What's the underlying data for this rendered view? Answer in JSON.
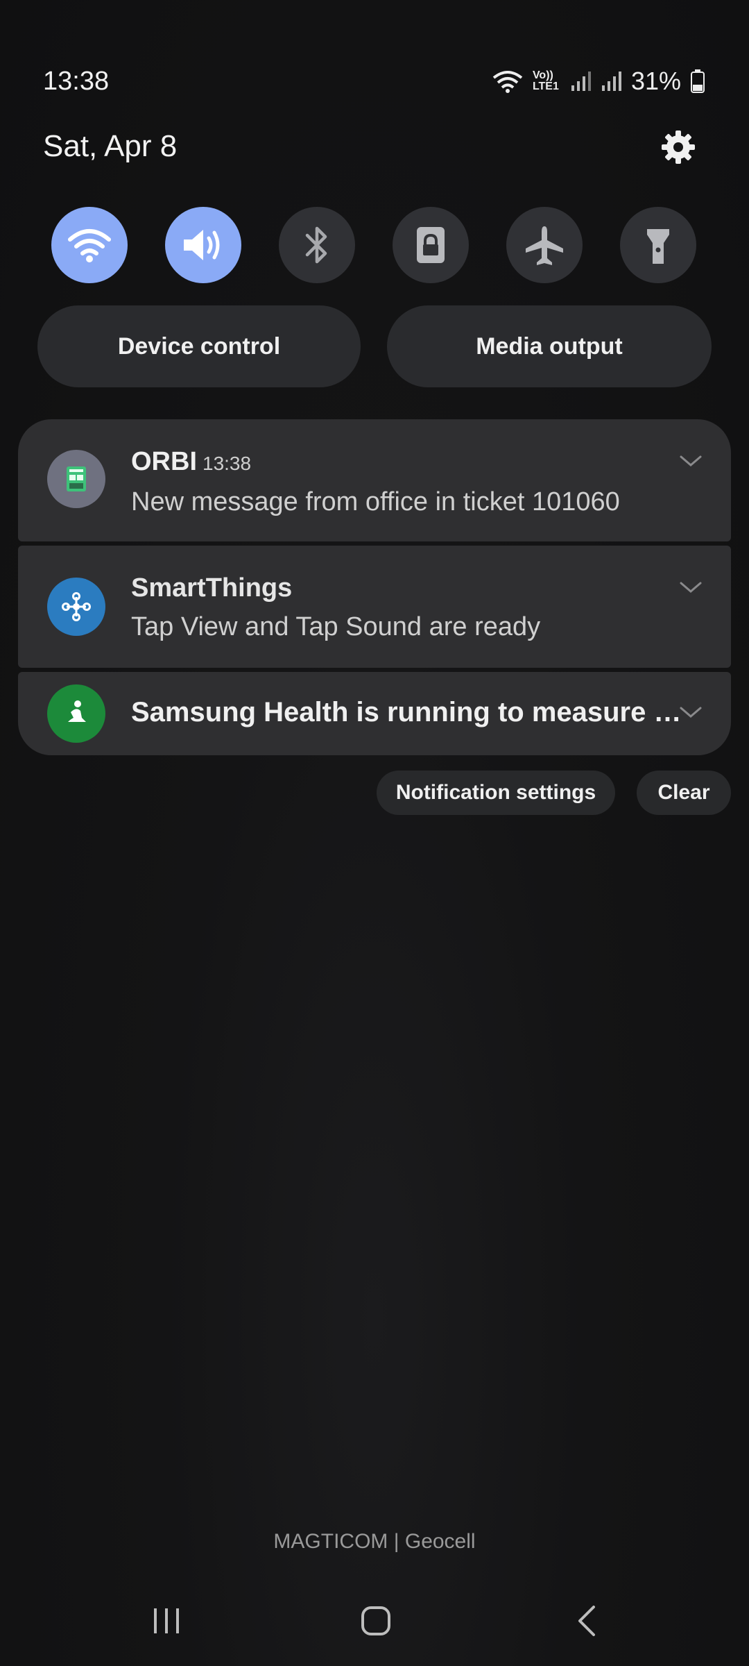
{
  "status_bar": {
    "time": "13:38",
    "network_label": "Vo)) LTE1",
    "battery_percent": "31%"
  },
  "header": {
    "date": "Sat, Apr 8",
    "settings_icon": "gear-icon"
  },
  "quick_settings": {
    "toggles": [
      {
        "name": "wifi",
        "icon": "wifi-icon",
        "on": true
      },
      {
        "name": "sound",
        "icon": "sound-icon",
        "on": true
      },
      {
        "name": "bluetooth",
        "icon": "bluetooth-icon",
        "on": false
      },
      {
        "name": "rotation-lock",
        "icon": "lock-icon",
        "on": false
      },
      {
        "name": "airplane-mode",
        "icon": "airplane-icon",
        "on": false
      },
      {
        "name": "flashlight",
        "icon": "flashlight-icon",
        "on": false
      }
    ],
    "device_control_label": "Device control",
    "media_output_label": "Media output"
  },
  "notifications": [
    {
      "app": "ORBI",
      "time": "13:38",
      "body": "New message from office in ticket 101060"
    },
    {
      "app": "SmartThings",
      "body": "Tap View and Tap Sound are ready"
    },
    {
      "app": "Samsung Health is running to measure your steps"
    }
  ],
  "actions": {
    "notification_settings_label": "Notification settings",
    "clear_label": "Clear"
  },
  "carrier": "MAGTICOM | Geocell",
  "colors": {
    "accent_on": "#8aaaf6",
    "toggle_off": "#303135",
    "card_bg": "#2f2f31"
  }
}
